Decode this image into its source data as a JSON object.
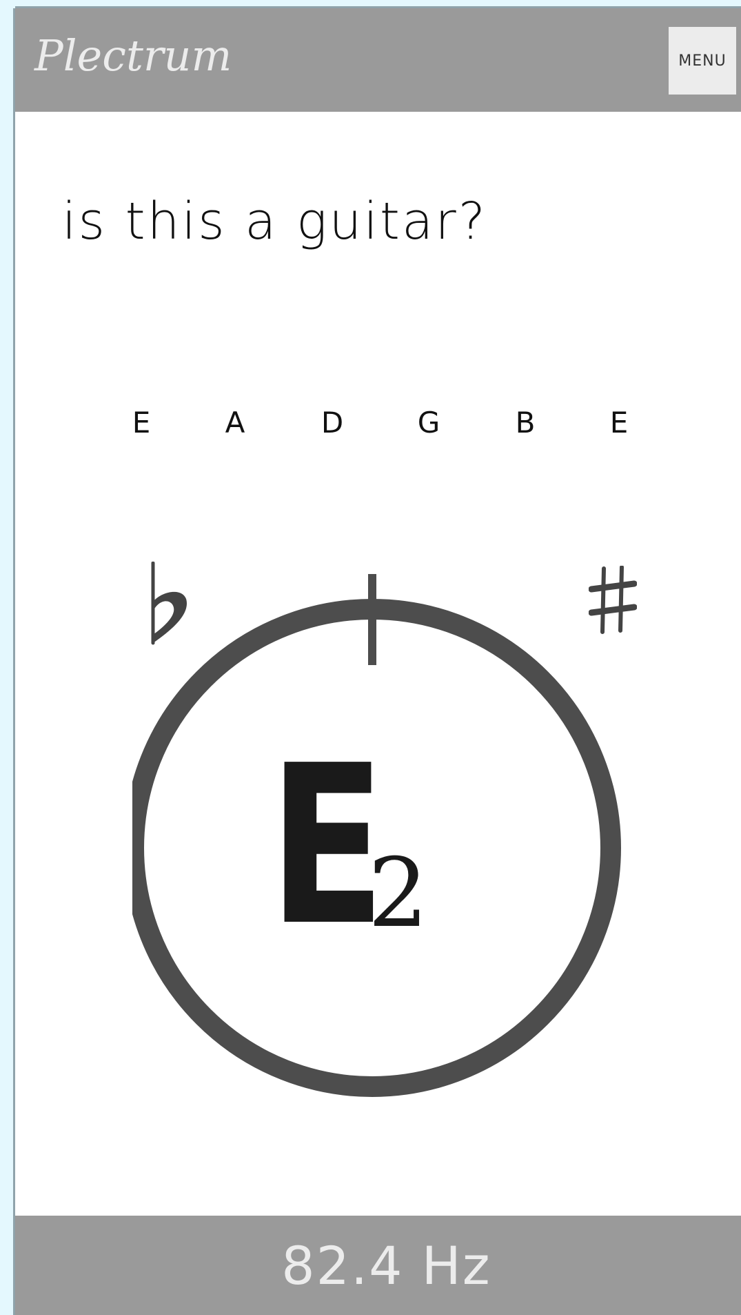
{
  "header": {
    "app_title": "Plectrum",
    "menu_label": "MENU"
  },
  "prompt": {
    "question": "is this a guitar?"
  },
  "strings": {
    "items": [
      "E",
      "A",
      "D",
      "G",
      "B",
      "E"
    ]
  },
  "tuner": {
    "flat_symbol": "♭",
    "sharp_symbol": "#",
    "note": "E",
    "octave": "2"
  },
  "footer": {
    "frequency": "82.4 Hz"
  },
  "colors": {
    "bar_background": "#9a9a9a",
    "bar_text": "#ececec",
    "dial_ring": "#4d4d4d",
    "page_background": "#e4f8fe"
  }
}
